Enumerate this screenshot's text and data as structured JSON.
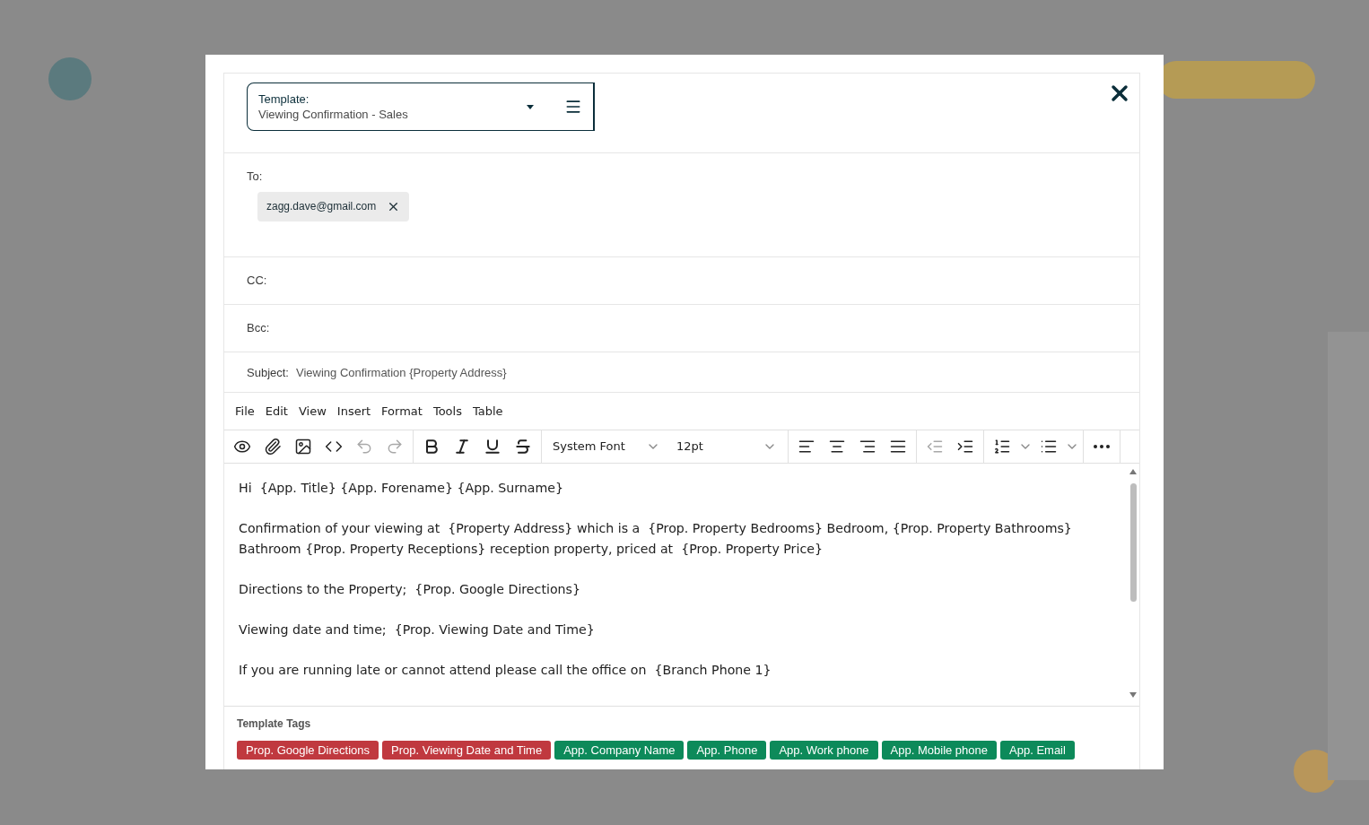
{
  "template": {
    "label": "Template:",
    "value": "Viewing Confirmation - Sales"
  },
  "recipients": {
    "to_label": "To:",
    "to": [
      "zagg.dave@gmail.com"
    ],
    "cc_label": "CC:",
    "bcc_label": "Bcc:"
  },
  "subject": {
    "label": "Subject:",
    "value": "Viewing Confirmation {Property Address}"
  },
  "editor": {
    "menu": [
      "File",
      "Edit",
      "View",
      "Insert",
      "Format",
      "Tools",
      "Table"
    ],
    "buttons": [
      {
        "disabled": false
      },
      {
        "disabled": false
      },
      {
        "disabled": false
      },
      {
        "disabled": false
      },
      {
        "disabled": true
      },
      {
        "disabled": true
      },
      {
        "disabled": false
      },
      {
        "disabled": false
      },
      {
        "disabled": false
      },
      {
        "disabled": false
      },
      {
        "disabled": false
      },
      {
        "disabled": false
      },
      {
        "disabled": false
      },
      {
        "disabled": false
      },
      {
        "disabled": true
      },
      {
        "disabled": false
      },
      {
        "disabled": false
      },
      {
        "disabled": false
      },
      {
        "disabled": false
      }
    ],
    "font": "System Font",
    "size": "12pt",
    "paragraphs": [
      "Hi  {App. Title} {App. Forename} {App. Surname}",
      "Confirmation of your viewing at  {Property Address} which is a  {Prop. Property Bedrooms} Bedroom, {Prop. Property Bathrooms} Bathroom {Prop. Property Receptions} reception property, priced at  {Prop. Property Price}",
      "Directions to the Property;  {Prop. Google Directions}",
      "Viewing date and time;  {Prop. Viewing Date and Time}",
      "If you are running late or cannot attend please call the office on  {Branch Phone 1}"
    ]
  },
  "tags": {
    "title": "Template Tags",
    "items": [
      {
        "label": "Prop. Google Directions",
        "color": "#c0393f"
      },
      {
        "label": "Prop. Viewing Date and Time",
        "color": "#c0393f"
      },
      {
        "label": "App. Company Name",
        "color": "#0d8a5a"
      },
      {
        "label": "App. Phone",
        "color": "#0d8a5a"
      },
      {
        "label": "App. Work phone",
        "color": "#0d8a5a"
      },
      {
        "label": "App. Mobile phone",
        "color": "#0d8a5a"
      },
      {
        "label": "App. Email",
        "color": "#0d8a5a"
      }
    ]
  }
}
